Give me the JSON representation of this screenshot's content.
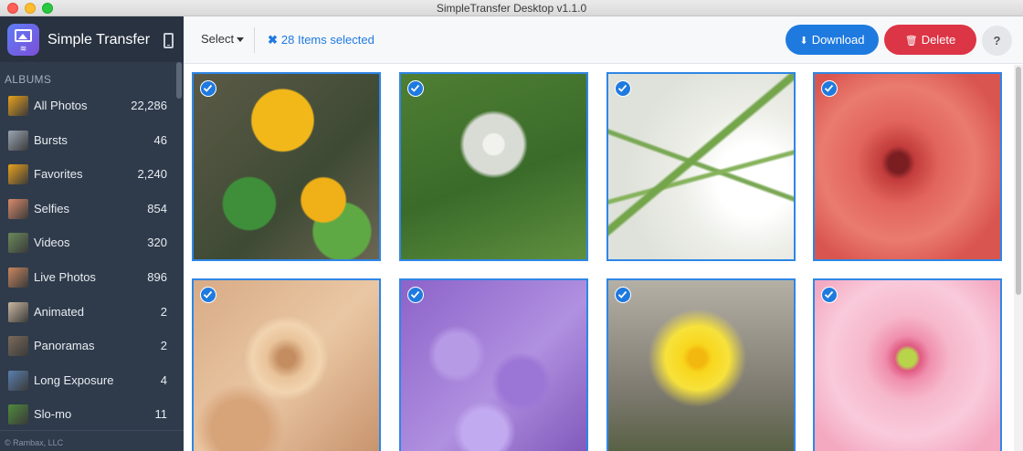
{
  "window": {
    "title": "SimpleTransfer Desktop v1.1.0"
  },
  "sidebar": {
    "brand": "Simple Transfer",
    "albums_heading": "ALBUMS",
    "albums": [
      {
        "name": "All Photos",
        "count": "22,286",
        "thumb_color": "#e8a11c"
      },
      {
        "name": "Bursts",
        "count": "46",
        "thumb_color": "#9aa5b3"
      },
      {
        "name": "Favorites",
        "count": "2,240",
        "thumb_color": "#e8a11c"
      },
      {
        "name": "Selfies",
        "count": "854",
        "thumb_color": "#d98a6b"
      },
      {
        "name": "Videos",
        "count": "320",
        "thumb_color": "#6a8a5a"
      },
      {
        "name": "Live Photos",
        "count": "896",
        "thumb_color": "#c9865f"
      },
      {
        "name": "Animated",
        "count": "2",
        "thumb_color": "#c9b7a0"
      },
      {
        "name": "Panoramas",
        "count": "2",
        "thumb_color": "#7a6a5a"
      },
      {
        "name": "Long Exposure",
        "count": "4",
        "thumb_color": "#5a7fae"
      },
      {
        "name": "Slo-mo",
        "count": "11",
        "thumb_color": "#4f8a3c"
      }
    ],
    "copyright": "© Rambax, LLC"
  },
  "toolbar": {
    "select_label": "Select",
    "selected_text": "28 Items selected",
    "download_label": "Download",
    "delete_label": "Delete",
    "help_label": "?"
  },
  "photos": [
    {
      "subject": "yellow poppies",
      "selected": true
    },
    {
      "subject": "dandelion seed head",
      "selected": true
    },
    {
      "subject": "white lily",
      "selected": true
    },
    {
      "subject": "red ranunculus",
      "selected": true
    },
    {
      "subject": "peach roses",
      "selected": true
    },
    {
      "subject": "purple crocuses",
      "selected": true
    },
    {
      "subject": "yellow daffodil",
      "selected": true
    },
    {
      "subject": "pink gerbera",
      "selected": true
    }
  ],
  "colors": {
    "accent": "#1f7ae0",
    "danger": "#dc3545",
    "sidebar": "#2f3b4b"
  }
}
